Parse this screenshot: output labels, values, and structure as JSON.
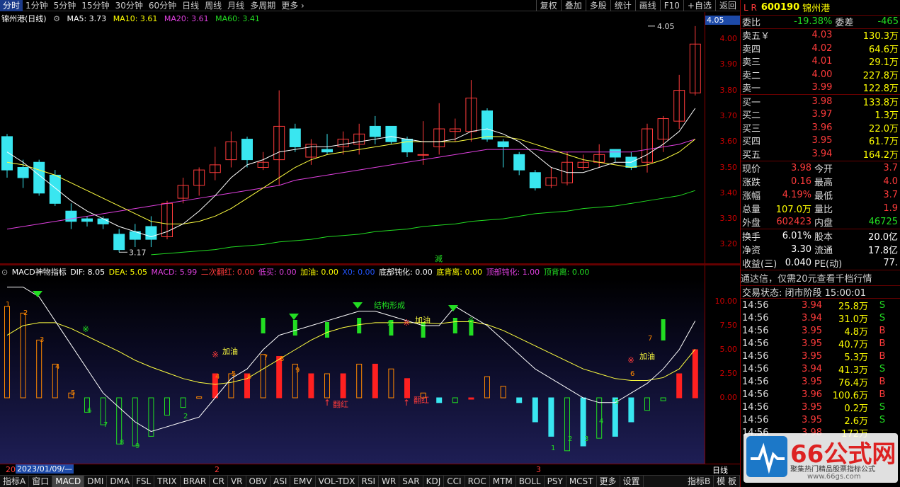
{
  "topbar": {
    "tabs": [
      "分时",
      "1分钟",
      "5分钟",
      "15分钟",
      "30分钟",
      "60分钟",
      "日线",
      "周线",
      "月线",
      "多周期",
      "更多"
    ],
    "more_icon": "chevron-right-icon",
    "actions": [
      "复权",
      "叠加",
      "多股",
      "统计",
      "画线",
      "F10",
      "+自选",
      "返回"
    ]
  },
  "main": {
    "stock": "锦州港(日线)",
    "ma5": "MA5: 3.73",
    "ma10": "MA10: 3.61",
    "ma20": "MA20: 3.61",
    "ma60": "MA60: 3.41",
    "current_price": "4.05",
    "high_label": "4.05",
    "low_label": "3.17",
    "reduce_tag": "減",
    "price_ticks": [
      "4.00",
      "3.90",
      "3.80",
      "3.70",
      "3.60",
      "3.50",
      "3.40",
      "3.30",
      "3.20"
    ]
  },
  "macd": {
    "title": "MACD神物指标",
    "dif": "DIF: 8.05",
    "dea": "DEA: 5.05",
    "macd": "MACD: 5.99",
    "flip_red": "二次翻红: 0.00",
    "low_buy": "低买: 0.00",
    "add_oil": "加油: 0.00",
    "x0": "X0: 0.00",
    "bottom_dull": "底部钝化: 0.00",
    "bottom_div": "底背离: 0.00",
    "top_dull": "顶部钝化: 1.00",
    "top_div": "顶背离: 0.00",
    "axis_ticks": [
      "10.00",
      "7.50",
      "5.00",
      "2.50",
      "0.00"
    ],
    "ann_structure": "结构形成",
    "ann_add": "加油",
    "ann_flip": "翻红"
  },
  "dates": {
    "start": "2023/01/09/—",
    "m2": "2",
    "m3": "3",
    "leftnum": "20",
    "period": "日线"
  },
  "bottombar": {
    "items": [
      "指标A",
      "窗口",
      "MACD",
      "DMI",
      "DMA",
      "FSL",
      "TRIX",
      "BRAR",
      "CR",
      "VR",
      "OBV",
      "ASI",
      "EMV",
      "VOL-TDX",
      "RSI",
      "WR",
      "SAR",
      "KDJ",
      "CCI",
      "ROC",
      "MTM",
      "BOLL",
      "PSY",
      "MCST",
      "更多",
      "设置"
    ],
    "right_items": [
      "指标B",
      "模 板"
    ]
  },
  "quote": {
    "prefix": "L R",
    "code": "600190",
    "name": "锦州港",
    "weibi_label": "委比",
    "weibi": "-19.38%",
    "weicha_label": "委差",
    "weicha": "-465",
    "asks": [
      {
        "label": "卖五￥",
        "price": "4.03",
        "vol": "130.3万"
      },
      {
        "label": "卖四",
        "price": "4.02",
        "vol": "64.6万"
      },
      {
        "label": "卖三",
        "price": "4.01",
        "vol": "29.1万"
      },
      {
        "label": "卖二",
        "price": "4.00",
        "vol": "227.8万"
      },
      {
        "label": "卖一",
        "price": "3.99",
        "vol": "122.8万"
      }
    ],
    "bids": [
      {
        "label": "买一",
        "price": "3.98",
        "vol": "133.8万"
      },
      {
        "label": "买二",
        "price": "3.97",
        "vol": "1.3万"
      },
      {
        "label": "买三",
        "price": "3.96",
        "vol": "22.0万"
      },
      {
        "label": "买四",
        "price": "3.95",
        "vol": "61.7万"
      },
      {
        "label": "买五",
        "price": "3.94",
        "vol": "164.2万"
      }
    ],
    "stats": [
      {
        "a": "现价",
        "b": "3.98",
        "c": "今开",
        "d": "3.7"
      },
      {
        "a": "涨跌",
        "b": "0.16",
        "c": "最高",
        "d": "4.0"
      },
      {
        "a": "涨幅",
        "b": "4.19%",
        "c": "最低",
        "d": "3.7"
      },
      {
        "a": "总量",
        "b": "107.0万",
        "c": "量比",
        "d": "1.9"
      },
      {
        "a": "外盘",
        "b": "602423",
        "c": "内盘",
        "d": "46725"
      }
    ],
    "stats2": [
      {
        "a": "换手",
        "b": "6.01%",
        "c": "股本",
        "d": "20.0亿"
      },
      {
        "a": "净资",
        "b": "3.30",
        "c": "流通",
        "d": "17.8亿"
      },
      {
        "a": "收益(三)",
        "b": "0.040",
        "c": "PE(动)",
        "d": "77."
      }
    ],
    "banner": "通达信，仅需20元查看千档行情",
    "status": "交易状态: 闭市阶段 15:00:01",
    "ticks": [
      {
        "t": "14:56",
        "p": "3.94",
        "v": "25.8万",
        "s": "S"
      },
      {
        "t": "14:56",
        "p": "3.94",
        "v": "31.0万",
        "s": "S"
      },
      {
        "t": "14:56",
        "p": "3.95",
        "v": "4.8万",
        "s": "B"
      },
      {
        "t": "14:56",
        "p": "3.95",
        "v": "40.7万",
        "s": "B"
      },
      {
        "t": "14:56",
        "p": "3.95",
        "v": "5.3万",
        "s": "B"
      },
      {
        "t": "14:56",
        "p": "3.94",
        "v": "41.3万",
        "s": "S"
      },
      {
        "t": "14:56",
        "p": "3.95",
        "v": "76.4万",
        "s": "B"
      },
      {
        "t": "14:56",
        "p": "3.96",
        "v": "100.6万",
        "s": "B"
      },
      {
        "t": "14:56",
        "p": "3.95",
        "v": "0.2万",
        "s": "S"
      },
      {
        "t": "14:56",
        "p": "3.95",
        "v": "2.6万",
        "s": "S"
      }
    ],
    "last_tick": {
      "t": "14:56",
      "p": "3.98",
      "v": "172万"
    }
  },
  "logo": {
    "title": "66公式网",
    "sub": "聚集热门精品股票指标公式",
    "url": "www.66gs.com"
  }
}
